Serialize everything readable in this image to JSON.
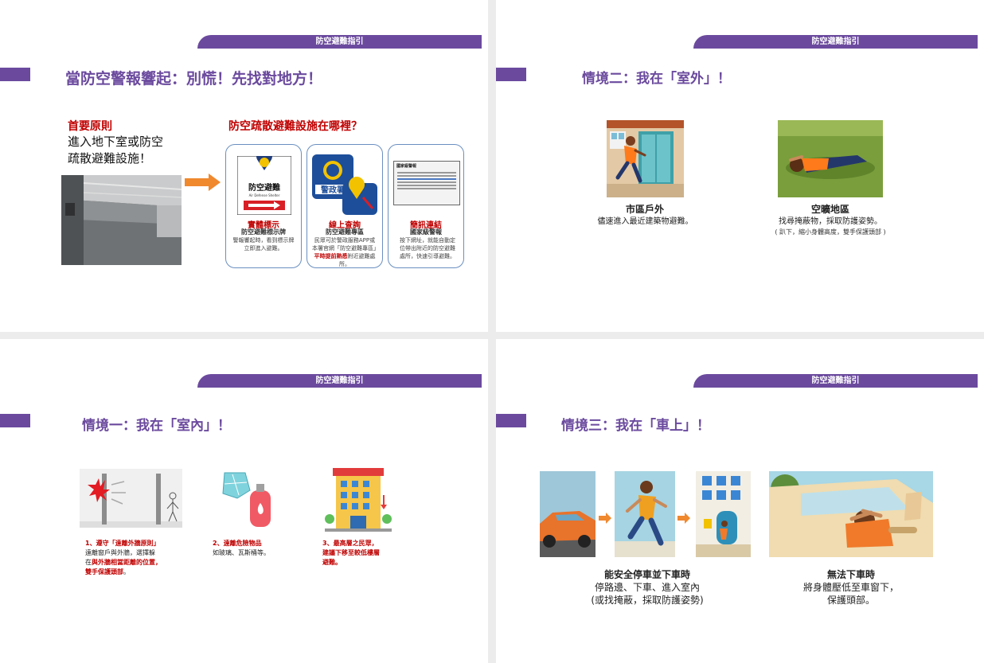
{
  "banner": "防空避難指引",
  "slide1": {
    "heading": "當防空警報響起：別慌！先找對地方！",
    "principle_title": "首要原則",
    "principle_lines": [
      "進入地下室或防空",
      "疏散避難設施！"
    ],
    "where_title": "防空疏散避難設施在哪裡？",
    "sign_text": "防空避難",
    "sign_sub": "Air Defense Shelter",
    "police_text": "警政署",
    "cards": [
      {
        "title": "實體標示",
        "subtitle": "防空避難標示牌",
        "body": "警報響起時，看到標示牌立即進入避難。"
      },
      {
        "title": "線上查詢",
        "subtitle": "防空避難專區",
        "body_a": "民眾可於警政服務APP或本署官網「防空避難專區」",
        "body_red": "平時提前熟悉",
        "body_b": "附近避難處所。"
      },
      {
        "title": "簡訊連結",
        "subtitle": "國家級警報",
        "body": "按下網址，就能自動定位帶出附近的防空避難處所，快速引導避難。"
      }
    ],
    "alert_header": "國家級警報"
  },
  "slide2": {
    "heading": "情境二：我在「室外」！",
    "left_title": "市區戶外",
    "left_body": "儘速進入最近建築物避難。",
    "right_title": "空曠地區",
    "right_body": "找尋掩蔽物，採取防護姿勢。",
    "right_note": "( 趴下，縮小身體高度，雙手保護頭部 )"
  },
  "slide3": {
    "heading": "情境一：我在「室內」！",
    "item1_title": "1、遵守「遠離外牆原則」",
    "item1_body": "遠離窗戶與外牆，選擇躲",
    "item1_body2a": "在",
    "item1_red": "與外牆相當距離的位置，",
    "item1_red2": "雙手保護頭部",
    "item1_end": "。",
    "item2_title": "2、遠離危險物品",
    "item2_body": "如玻璃、瓦斯桶等。",
    "item3_title": "3、最高層之民眾，",
    "item3_red": "建議下移至較低樓層",
    "item3_red2": "避難。"
  },
  "slide4": {
    "heading": "情境三：我在「車上」！",
    "left_title": "能安全停車並下車時",
    "left_line1": "停路邊、下車、進入室內",
    "left_line2": "(或找掩蔽，採取防護姿勢)",
    "right_title": "無法下車時",
    "right_line1": "將身體壓低至車窗下，",
    "right_line2": "保護頭部。"
  },
  "colors": {
    "brand_purple": "#6b4a9e",
    "alert_red": "#c00000",
    "arrow_orange": "#f0882e",
    "card_border": "#6a8fc0"
  }
}
